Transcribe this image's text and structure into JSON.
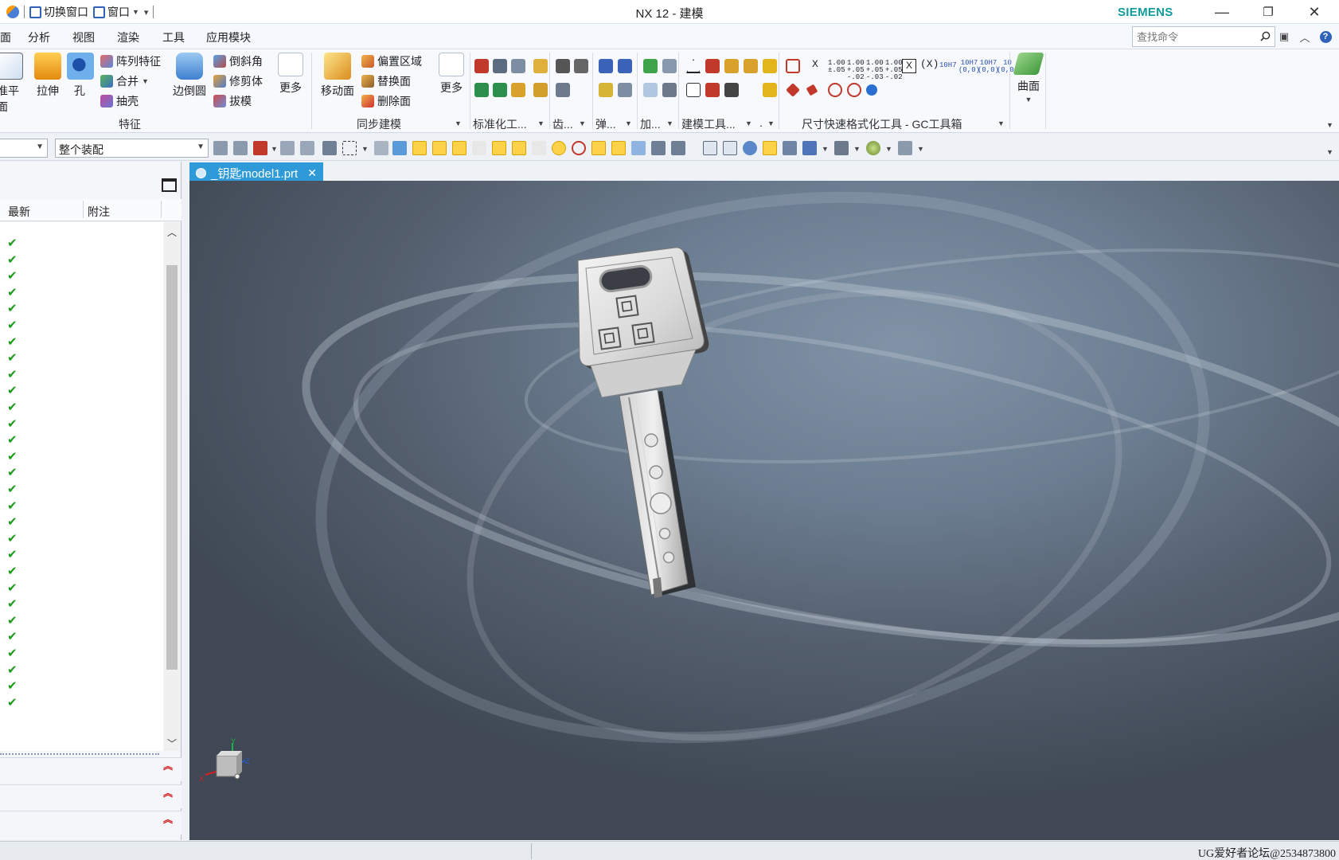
{
  "window": {
    "title": "NX 12 - 建模",
    "brand": "SIEMENS",
    "minimize_glyph": "—",
    "restore_glyph": "❐",
    "close_glyph": "✕"
  },
  "quick_access": {
    "switch_window": "切换窗口",
    "window": "窗口"
  },
  "menu": {
    "items": [
      "面",
      "分析",
      "视图",
      "渲染",
      "工具",
      "应用模块"
    ]
  },
  "command_search": {
    "placeholder": "查找命令"
  },
  "ribbon": {
    "feature_group": {
      "label": "特征",
      "datum_plane": "基准平面",
      "extrude": "拉伸",
      "hole": "孔",
      "pattern_feature": "阵列特征",
      "unite": "合并",
      "shell": "抽壳",
      "edge_blend": "边倒圆",
      "chamfer": "倒斜角",
      "trim_body": "修剪体",
      "draft": "拔模",
      "more": "更多"
    },
    "sync_group": {
      "label": "同步建模",
      "move_face": "移动面",
      "offset_region": "偏置区域",
      "replace_face": "替换面",
      "delete_face": "删除面",
      "more": "更多"
    },
    "standard_group": {
      "label": "标准化工..."
    },
    "gear_group": {
      "label": "齿..."
    },
    "spring_group": {
      "label": "弹..."
    },
    "add_group": {
      "label": "加..."
    },
    "modeling_tools_group": {
      "label": "建模工具..."
    },
    "dim_group": {
      "label": "尺寸快速格式化工具 - GC工具箱",
      "x_label": "X",
      "tol1": "1.00\n±.05",
      "tol2": "1.00\n+.05\n-.02",
      "tol3": "1.00\n+.05\n-.03",
      "tol4": "1.00\n+.05\n-.02",
      "paren": "(X)",
      "fit1": "10H7",
      "fit2": "10H7\n(0,0)",
      "fit3": "10H7\n(0,0)",
      "fit4": "10\n(0,0)"
    },
    "surface_group": {
      "surface": "曲面"
    }
  },
  "selection_bar": {
    "filter_value": "",
    "scope_value": "整个装配"
  },
  "navigator": {
    "columns": [
      "最新",
      "附注"
    ],
    "check_count": 29,
    "check_glyph": "✔"
  },
  "document_tab": {
    "label": "_钥匙model1.prt",
    "close": "✕"
  },
  "triad": {
    "x": "X",
    "y": "Y",
    "z": "Z"
  },
  "statusbar": {
    "text": "UG爱好者论坛@2534873800"
  }
}
